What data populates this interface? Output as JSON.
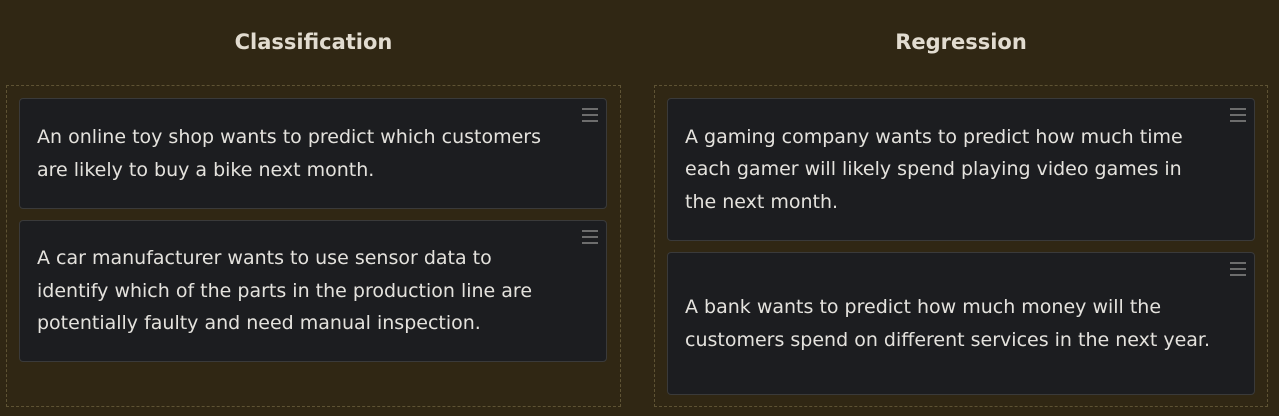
{
  "columns": [
    {
      "title": "Classification",
      "cards": [
        {
          "text": "An online toy shop wants to predict which customers are likely to buy a bike next month."
        },
        {
          "text": "A car manufacturer wants to use sensor data to identify which of the parts in the production line are potentially faulty and need manual inspection."
        }
      ]
    },
    {
      "title": "Regression",
      "cards": [
        {
          "text": "A gaming company wants to predict how much time each gamer will likely spend playing video games in the next month."
        },
        {
          "text": "A bank wants to predict how much money will the customers spend on different services in the next year."
        }
      ]
    }
  ],
  "icons": {
    "drag_handle": "hamburger-drag-icon"
  },
  "colors": {
    "background": "#302714",
    "card": "#1c1d20",
    "title_text": "#e2dcd0",
    "card_text": "#e4e2dd",
    "dropzone_border": "#5e5334"
  }
}
